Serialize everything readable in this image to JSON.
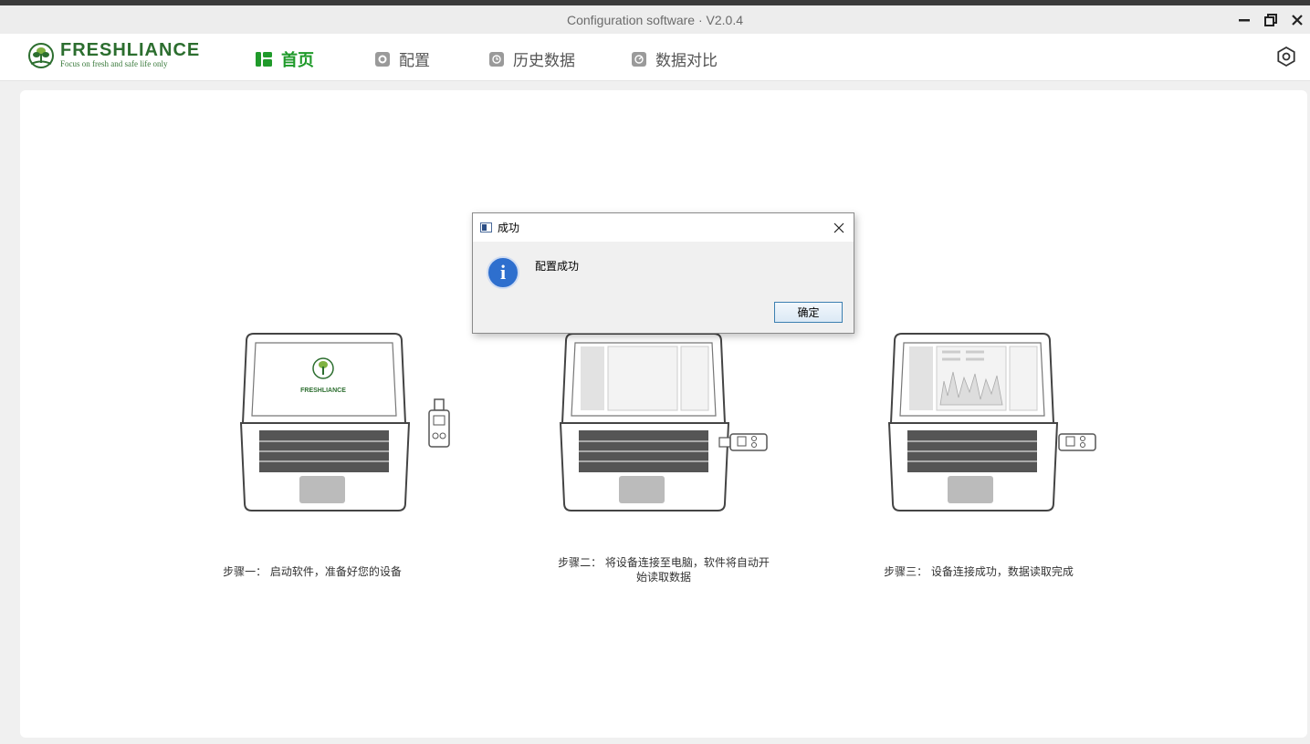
{
  "window": {
    "title": "Configuration software · V2.0.4"
  },
  "brand": {
    "name": "FRESHLIANCE",
    "tagline": "Focus on fresh and safe life only",
    "color": "#2c6e2f"
  },
  "nav": {
    "items": [
      {
        "label": "首页",
        "icon": "home-icon",
        "active": true
      },
      {
        "label": "配置",
        "icon": "gear-icon",
        "active": false
      },
      {
        "label": "历史数据",
        "icon": "clock-icon",
        "active": false
      },
      {
        "label": "数据对比",
        "icon": "compare-icon",
        "active": false
      }
    ],
    "active_color": "#1f9a2a"
  },
  "steps": [
    {
      "text": "步骤一： 启动软件，准备好您的设备"
    },
    {
      "text": "步骤二： 将设备连接至电脑，软件将自动开始读取数据"
    },
    {
      "text": "步骤三： 设备连接成功，数据读取完成"
    }
  ],
  "dialog": {
    "title": "成功",
    "message": "配置成功",
    "ok_label": "确定",
    "info_glyph": "i"
  }
}
